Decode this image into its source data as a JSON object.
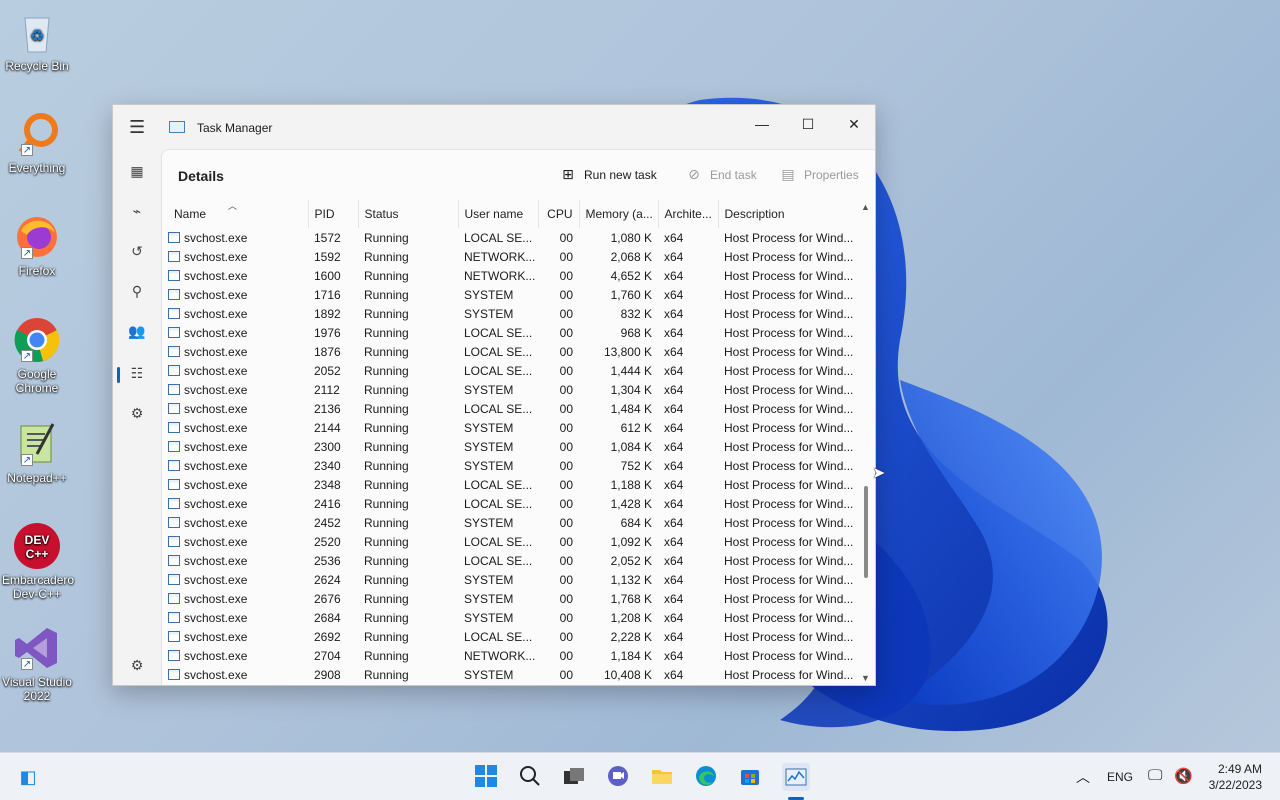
{
  "desktop": {
    "icons": [
      {
        "label": "Recycle Bin",
        "icon": "recycle-bin-icon"
      },
      {
        "label": "Everything",
        "icon": "everything-search-icon"
      },
      {
        "label": "Firefox",
        "icon": "firefox-icon"
      },
      {
        "label": "Google Chrome",
        "icon": "chrome-icon"
      },
      {
        "label": "Notepad++",
        "icon": "notepadpp-icon"
      },
      {
        "label": "Embarcadero Dev-C++",
        "icon": "devcpp-icon"
      },
      {
        "label": "Visual Studio 2022",
        "icon": "visual-studio-icon"
      }
    ]
  },
  "window": {
    "title": "Task Manager",
    "page_heading": "Details",
    "commands": {
      "run_new_task": "Run new task",
      "end_task": "End task",
      "properties": "Properties"
    },
    "columns": [
      "Name",
      "PID",
      "Status",
      "User name",
      "CPU",
      "Memory (a...",
      "Archite...",
      "Description"
    ],
    "rows": [
      [
        "svchost.exe",
        "1572",
        "Running",
        "LOCAL SE...",
        "00",
        "1,080 K",
        "x64",
        "Host Process for Wind..."
      ],
      [
        "svchost.exe",
        "1592",
        "Running",
        "NETWORK...",
        "00",
        "2,068 K",
        "x64",
        "Host Process for Wind..."
      ],
      [
        "svchost.exe",
        "1600",
        "Running",
        "NETWORK...",
        "00",
        "4,652 K",
        "x64",
        "Host Process for Wind..."
      ],
      [
        "svchost.exe",
        "1716",
        "Running",
        "SYSTEM",
        "00",
        "1,760 K",
        "x64",
        "Host Process for Wind..."
      ],
      [
        "svchost.exe",
        "1892",
        "Running",
        "SYSTEM",
        "00",
        "832 K",
        "x64",
        "Host Process for Wind..."
      ],
      [
        "svchost.exe",
        "1976",
        "Running",
        "LOCAL SE...",
        "00",
        "968 K",
        "x64",
        "Host Process for Wind..."
      ],
      [
        "svchost.exe",
        "1876",
        "Running",
        "LOCAL SE...",
        "00",
        "13,800 K",
        "x64",
        "Host Process for Wind..."
      ],
      [
        "svchost.exe",
        "2052",
        "Running",
        "LOCAL SE...",
        "00",
        "1,444 K",
        "x64",
        "Host Process for Wind..."
      ],
      [
        "svchost.exe",
        "2112",
        "Running",
        "SYSTEM",
        "00",
        "1,304 K",
        "x64",
        "Host Process for Wind..."
      ],
      [
        "svchost.exe",
        "2136",
        "Running",
        "LOCAL SE...",
        "00",
        "1,484 K",
        "x64",
        "Host Process for Wind..."
      ],
      [
        "svchost.exe",
        "2144",
        "Running",
        "SYSTEM",
        "00",
        "612 K",
        "x64",
        "Host Process for Wind..."
      ],
      [
        "svchost.exe",
        "2300",
        "Running",
        "SYSTEM",
        "00",
        "1,084 K",
        "x64",
        "Host Process for Wind..."
      ],
      [
        "svchost.exe",
        "2340",
        "Running",
        "SYSTEM",
        "00",
        "752 K",
        "x64",
        "Host Process for Wind..."
      ],
      [
        "svchost.exe",
        "2348",
        "Running",
        "LOCAL SE...",
        "00",
        "1,188 K",
        "x64",
        "Host Process for Wind..."
      ],
      [
        "svchost.exe",
        "2416",
        "Running",
        "LOCAL SE...",
        "00",
        "1,428 K",
        "x64",
        "Host Process for Wind..."
      ],
      [
        "svchost.exe",
        "2452",
        "Running",
        "SYSTEM",
        "00",
        "684 K",
        "x64",
        "Host Process for Wind..."
      ],
      [
        "svchost.exe",
        "2520",
        "Running",
        "LOCAL SE...",
        "00",
        "1,092 K",
        "x64",
        "Host Process for Wind..."
      ],
      [
        "svchost.exe",
        "2536",
        "Running",
        "LOCAL SE...",
        "00",
        "2,052 K",
        "x64",
        "Host Process for Wind..."
      ],
      [
        "svchost.exe",
        "2624",
        "Running",
        "SYSTEM",
        "00",
        "1,132 K",
        "x64",
        "Host Process for Wind..."
      ],
      [
        "svchost.exe",
        "2676",
        "Running",
        "SYSTEM",
        "00",
        "1,768 K",
        "x64",
        "Host Process for Wind..."
      ],
      [
        "svchost.exe",
        "2684",
        "Running",
        "SYSTEM",
        "00",
        "1,208 K",
        "x64",
        "Host Process for Wind..."
      ],
      [
        "svchost.exe",
        "2692",
        "Running",
        "LOCAL SE...",
        "00",
        "2,228 K",
        "x64",
        "Host Process for Wind..."
      ],
      [
        "svchost.exe",
        "2704",
        "Running",
        "NETWORK...",
        "00",
        "1,184 K",
        "x64",
        "Host Process for Wind..."
      ],
      [
        "svchost.exe",
        "2908",
        "Running",
        "SYSTEM",
        "00",
        "10,408 K",
        "x64",
        "Host Process for Wind..."
      ]
    ],
    "sidebar_icons": [
      "processes-icon",
      "performance-icon",
      "app-history-icon",
      "startup-apps-icon",
      "users-icon",
      "details-icon",
      "services-icon",
      "settings-icon"
    ]
  },
  "taskbar": {
    "icons": [
      "start-icon",
      "search-icon",
      "task-view-icon",
      "chat-icon",
      "file-explorer-icon",
      "edge-icon",
      "store-icon",
      "task-manager-icon"
    ],
    "language": "ENG",
    "time": "2:49 AM",
    "date": "3/22/2023"
  },
  "colors": {
    "accent": "#0067c0",
    "wallpaper_blue": "#1a4fd6"
  }
}
